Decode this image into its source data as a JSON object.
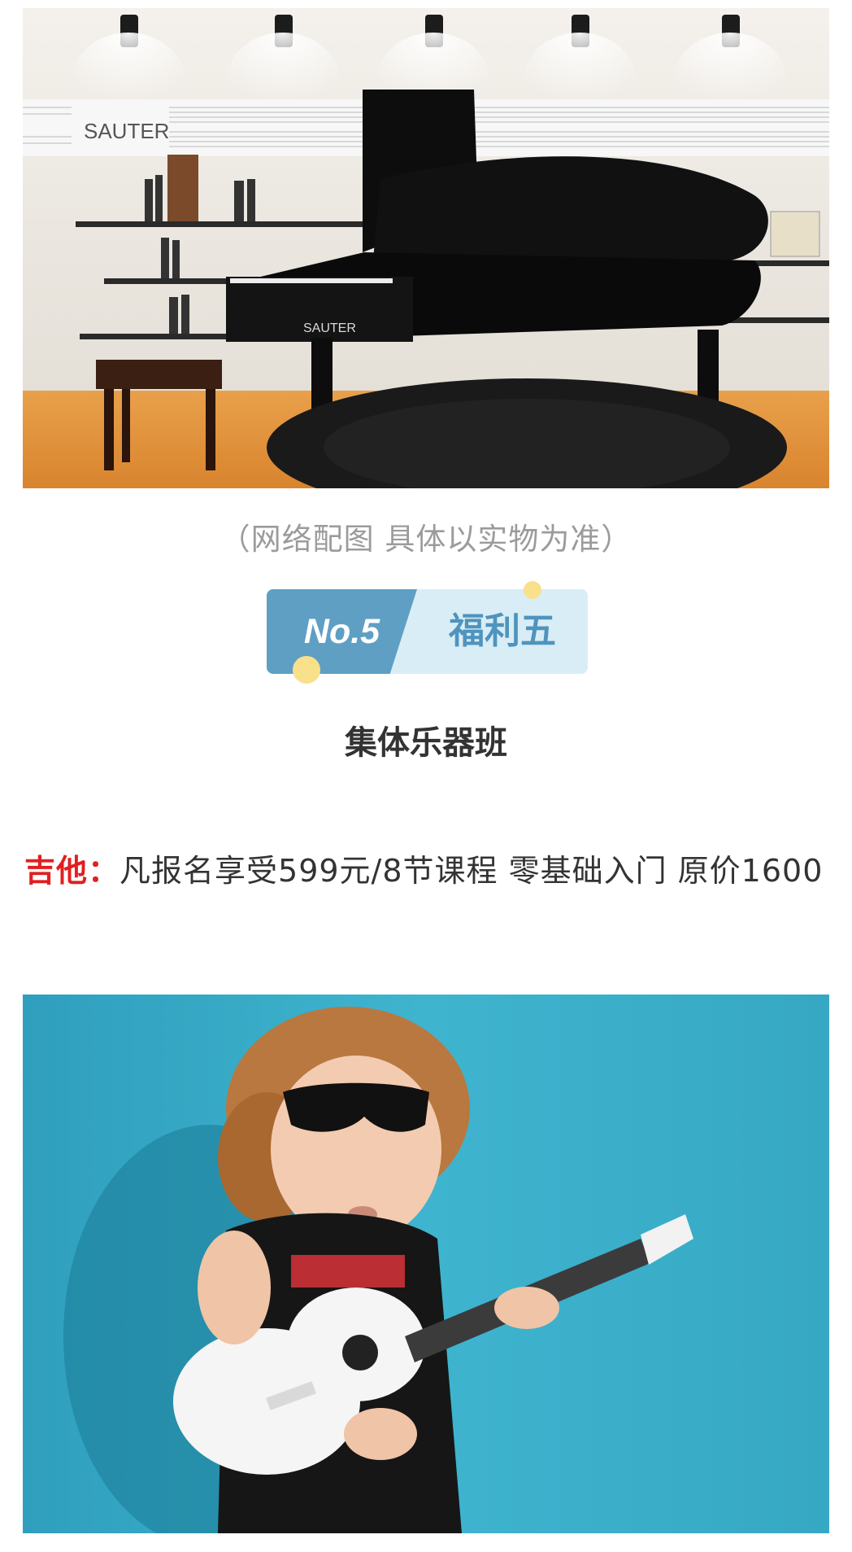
{
  "caption": "（网络配图 具体以实物为准）",
  "badge": {
    "number": "No.5",
    "title": "福利五"
  },
  "section_title": "集体乐器班",
  "offer": {
    "label": "吉他：",
    "text": "凡报名享受599元/8节课程  零基础入门 原价1600"
  },
  "piano_brand_wall": "SAUTER",
  "piano_brand_body": "SAUTER",
  "colors": {
    "badge_dark": "#5f9fc4",
    "badge_light": "#d9edf6",
    "accent_dot": "#f9e08a",
    "label_red": "#e02020",
    "photo_teal": "#3aaec8"
  }
}
